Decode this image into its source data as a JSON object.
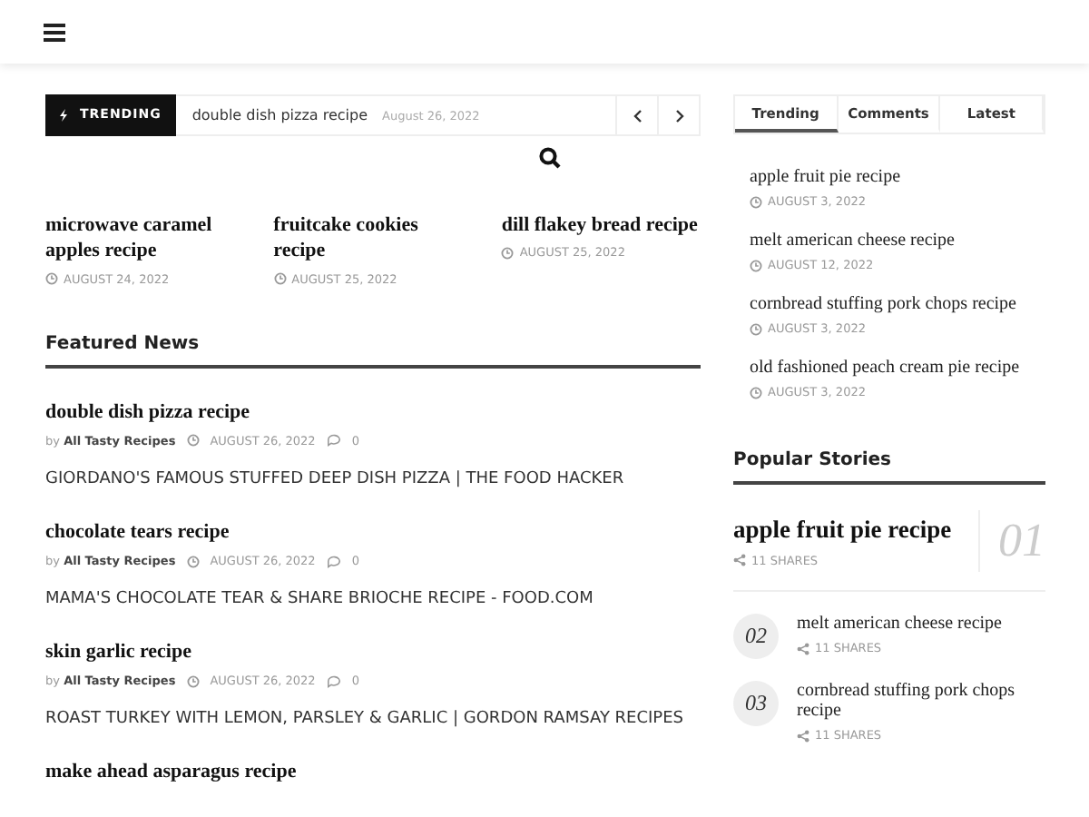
{
  "trending_bar": {
    "label": "TRENDING",
    "headline": "double dish pizza recipe",
    "date": "August 26, 2022"
  },
  "top_posts": [
    {
      "title": "microwave caramel apples recipe",
      "date": "AUGUST 24, 2022"
    },
    {
      "title": "fruitcake cookies recipe",
      "date": "AUGUST 25, 2022"
    },
    {
      "title": "dill flakey bread recipe",
      "date": "AUGUST 25, 2022"
    }
  ],
  "featured": {
    "heading": "Featured News",
    "articles": [
      {
        "title": "double dish pizza recipe",
        "by": "by",
        "author": "All Tasty Recipes",
        "date": "AUGUST 26, 2022",
        "comments": "0",
        "excerpt": "GIORDANO'S FAMOUS STUFFED DEEP DISH PIZZA | THE FOOD HACKER"
      },
      {
        "title": "chocolate tears recipe",
        "by": "by",
        "author": "All Tasty Recipes",
        "date": "AUGUST 26, 2022",
        "comments": "0",
        "excerpt": "MAMA'S CHOCOLATE TEAR & SHARE BRIOCHE RECIPE - FOOD.COM"
      },
      {
        "title": "skin garlic recipe",
        "by": "by",
        "author": "All Tasty Recipes",
        "date": "AUGUST 26, 2022",
        "comments": "0",
        "excerpt": "ROAST TURKEY WITH LEMON, PARSLEY & GARLIC | GORDON RAMSAY RECIPES"
      },
      {
        "title": "make ahead asparagus recipe"
      }
    ]
  },
  "sidebar_tabs": [
    {
      "label": "Trending",
      "selected": true
    },
    {
      "label": "Comments",
      "selected": false
    },
    {
      "label": "Latest",
      "selected": false
    }
  ],
  "sidebar_list": [
    {
      "title": "apple fruit pie recipe",
      "date": "AUGUST 3, 2022"
    },
    {
      "title": "melt american cheese recipe",
      "date": "AUGUST 12, 2022"
    },
    {
      "title": "cornbread stuffing pork chops recipe",
      "date": "AUGUST 3, 2022"
    },
    {
      "title": "old fashioned peach cream pie recipe",
      "date": "AUGUST 3, 2022"
    }
  ],
  "popular": {
    "heading": "Popular Stories",
    "items": [
      {
        "rank": "01",
        "title": "apple fruit pie recipe",
        "shares": "11 SHARES",
        "kind": "large"
      },
      {
        "rank": "02",
        "title": "melt american cheese recipe",
        "shares": "11 SHARES",
        "kind": "small"
      },
      {
        "rank": "03",
        "title": "cornbread stuffing pork chops recipe",
        "shares": "11 SHARES",
        "kind": "small"
      }
    ]
  }
}
